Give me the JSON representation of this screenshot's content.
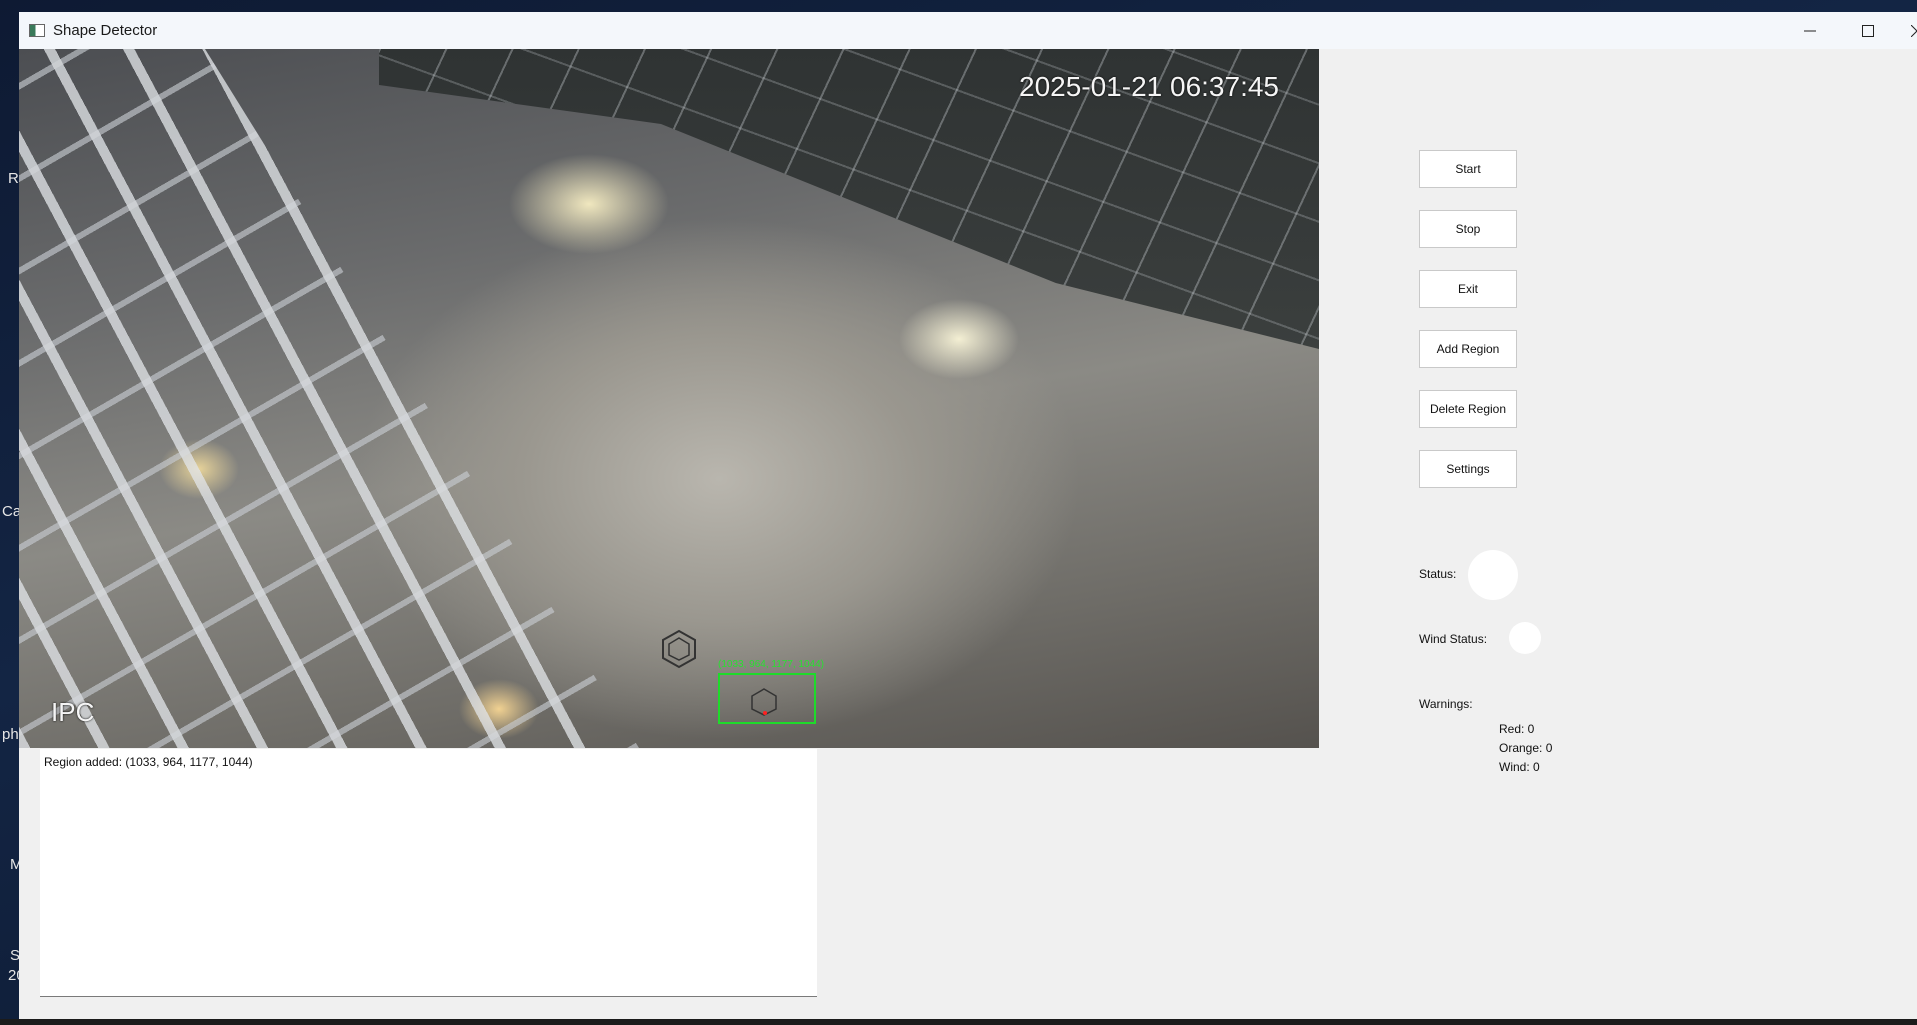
{
  "desktop": {
    "edge_labels": [
      "R",
      "Ca",
      "ph",
      "M",
      "S",
      "20"
    ]
  },
  "window": {
    "title": "Shape Detector",
    "icon": "app-window-icon",
    "controls": {
      "minimize_icon": "minimize-icon",
      "maximize_icon": "maximize-icon",
      "close_icon": "close-icon"
    }
  },
  "video": {
    "timestamp": "2025-01-21 06:37:45",
    "camera_label": "IPC",
    "region_overlay_label": "(1033, 964, 1177, 1044)",
    "colors": {
      "region_box": "#1edb2a",
      "center_dot": "#ff2020"
    }
  },
  "log": {
    "lines": [
      "Region added: (1033, 964, 1177, 1044)"
    ]
  },
  "controls": {
    "start": "Start",
    "stop": "Stop",
    "exit": "Exit",
    "add_region": "Add Region",
    "delete_region": "Delete Region",
    "settings": "Settings"
  },
  "status": {
    "status_label": "Status:",
    "wind_status_label": "Wind Status:",
    "indicator_color": "#ffffff"
  },
  "warnings": {
    "title": "Warnings:",
    "red": "Red: 0",
    "orange": "Orange: 0",
    "wind": "Wind: 0"
  }
}
